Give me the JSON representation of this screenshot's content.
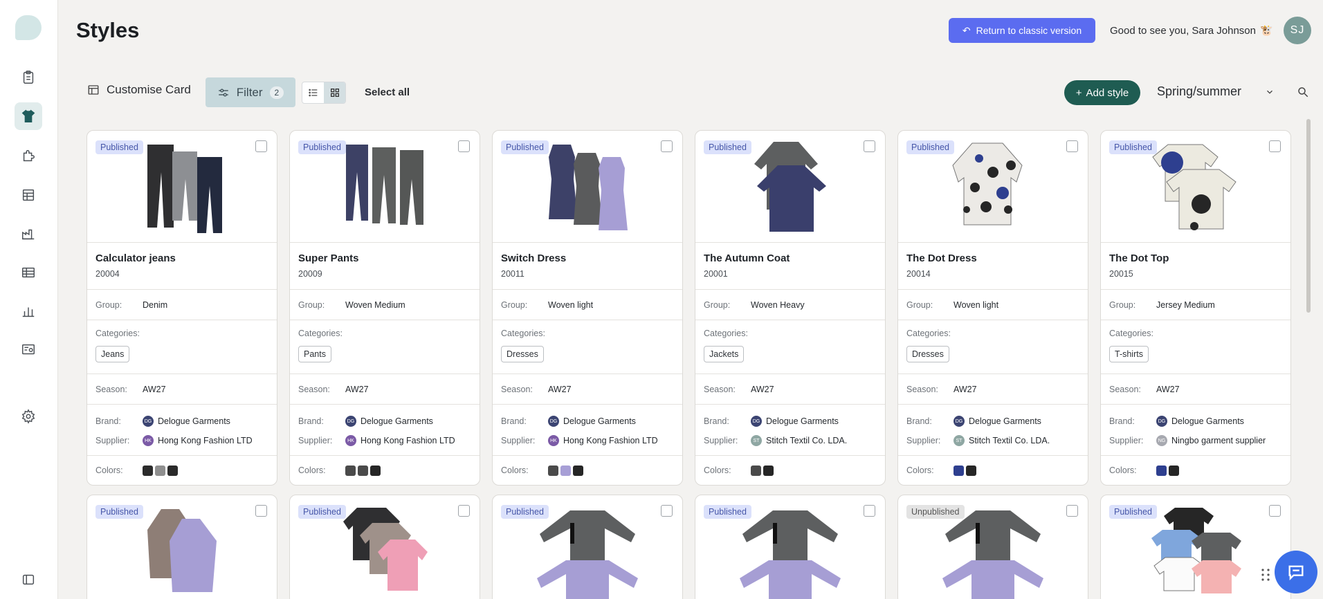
{
  "header": {
    "title": "Styles",
    "classic_button": "Return to classic version",
    "greeting": "Good to see you, Sara Johnson",
    "avatar_initials": "SJ"
  },
  "toolbar": {
    "customise_label": "Customise Card",
    "filter_label": "Filter",
    "filter_count": "2",
    "select_all": "Select all",
    "add_style": "Add style",
    "season": "Spring/summer"
  },
  "labels": {
    "group": "Group:",
    "categories": "Categories:",
    "season": "Season:",
    "brand": "Brand:",
    "supplier": "Supplier:",
    "colors": "Colors:"
  },
  "cards": [
    {
      "status": "Published",
      "name": "Calculator jeans",
      "code": "20004",
      "group": "Denim",
      "category": "Jeans",
      "season": "AW27",
      "brand": "Delogue Garments",
      "brand_initials": "DG",
      "supplier": "Hong Kong Fashion LTD",
      "supplier_initials": "HK",
      "colors": [
        "#2b2b2b",
        "#8f8f8f",
        "#2a2a2a"
      ]
    },
    {
      "status": "Published",
      "name": "Super Pants",
      "code": "20009",
      "group": "Woven Medium",
      "category": "Pants",
      "season": "AW27",
      "brand": "Delogue Garments",
      "brand_initials": "DG",
      "supplier": "Hong Kong Fashion LTD",
      "supplier_initials": "HK",
      "colors": [
        "#4a4a4a",
        "#4a4a4a",
        "#262626"
      ]
    },
    {
      "status": "Published",
      "name": "Switch Dress",
      "code": "20011",
      "group": "Woven light",
      "category": "Dresses",
      "season": "AW27",
      "brand": "Delogue Garments",
      "brand_initials": "DG",
      "supplier": "Hong Kong Fashion LTD",
      "supplier_initials": "HK",
      "colors": [
        "#4a4a4a",
        "#a79fd6",
        "#262626"
      ]
    },
    {
      "status": "Published",
      "name": "The Autumn Coat",
      "code": "20001",
      "group": "Woven Heavy",
      "category": "Jackets",
      "season": "AW27",
      "brand": "Delogue Garments",
      "brand_initials": "DG",
      "supplier": "Stitch Textil Co. LDA.",
      "supplier_initials": "ST",
      "colors": [
        "#4a4a4a",
        "#262626"
      ]
    },
    {
      "status": "Published",
      "name": "The Dot Dress",
      "code": "20014",
      "group": "Woven light",
      "category": "Dresses",
      "season": "AW27",
      "brand": "Delogue Garments",
      "brand_initials": "DG",
      "supplier": "Stitch Textil Co. LDA.",
      "supplier_initials": "ST",
      "colors": [
        "#2e3f8f",
        "#262626"
      ]
    },
    {
      "status": "Published",
      "name": "The Dot Top",
      "code": "20015",
      "group": "Jersey Medium",
      "category": "T-shirts",
      "season": "AW27",
      "brand": "Delogue Garments",
      "brand_initials": "DG",
      "supplier": "Ningbo garment supplier",
      "supplier_initials": "NG",
      "colors": [
        "#2e3f8f",
        "#262626"
      ]
    }
  ],
  "second_row": [
    {
      "status": "Published"
    },
    {
      "status": "Published"
    },
    {
      "status": "Published"
    },
    {
      "status": "Published"
    },
    {
      "status": "Unpublished"
    },
    {
      "status": "Published"
    }
  ]
}
